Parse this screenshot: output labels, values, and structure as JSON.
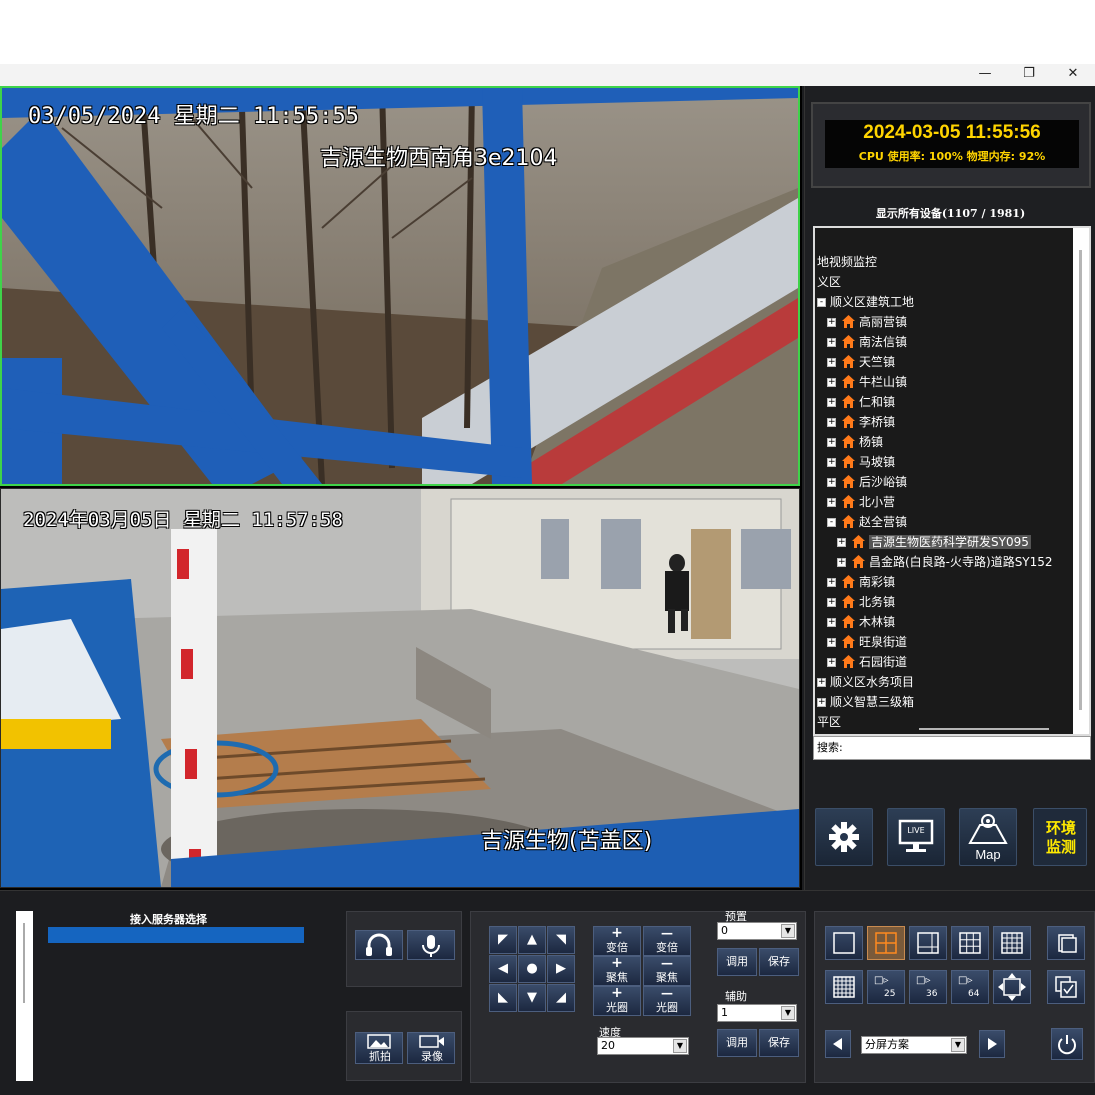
{
  "window": {
    "min_glyph": "—",
    "max_glyph": "❐",
    "close_glyph": "✕"
  },
  "cameras": [
    {
      "osd_time": "03/05/2024  星期二  11:55:55",
      "osd_name": "吉源生物西南角3e2104"
    },
    {
      "osd_time": "2024年03月05日  星期二  11:57:58",
      "osd_name": "吉源生物(苫盖区)"
    }
  ],
  "clock": {
    "datetime": "2024-03-05 11:55:56",
    "stats": "CPU 使用率: 100% 物理内存: 92%"
  },
  "device_header": "显示所有设备(1107 / 1981)",
  "tree": [
    {
      "label": "地视频监控",
      "level": 0,
      "expander": "",
      "icon": false
    },
    {
      "label": "义区",
      "level": 0,
      "expander": "",
      "icon": false
    },
    {
      "label": "顺义区建筑工地",
      "level": 1,
      "expander": "-",
      "icon": false
    },
    {
      "label": "高丽营镇",
      "level": 2,
      "expander": "+",
      "icon": true
    },
    {
      "label": "南法信镇",
      "level": 2,
      "expander": "+",
      "icon": true
    },
    {
      "label": "天竺镇",
      "level": 2,
      "expander": "+",
      "icon": true
    },
    {
      "label": "牛栏山镇",
      "level": 2,
      "expander": "+",
      "icon": true
    },
    {
      "label": "仁和镇",
      "level": 2,
      "expander": "+",
      "icon": true
    },
    {
      "label": "李桥镇",
      "level": 2,
      "expander": "+",
      "icon": true
    },
    {
      "label": "杨镇",
      "level": 2,
      "expander": "+",
      "icon": true
    },
    {
      "label": "马坡镇",
      "level": 2,
      "expander": "+",
      "icon": true
    },
    {
      "label": "后沙峪镇",
      "level": 2,
      "expander": "+",
      "icon": true
    },
    {
      "label": "北小营",
      "level": 2,
      "expander": "+",
      "icon": true
    },
    {
      "label": "赵全营镇",
      "level": 2,
      "expander": "-",
      "icon": true
    },
    {
      "label": "吉源生物医药科学研发SY095",
      "level": 3,
      "expander": "+",
      "icon": true,
      "selected": true
    },
    {
      "label": "昌金路(白良路-火寺路)道路SY152",
      "level": 3,
      "expander": "+",
      "icon": true
    },
    {
      "label": "南彩镇",
      "level": 2,
      "expander": "+",
      "icon": true
    },
    {
      "label": "北务镇",
      "level": 2,
      "expander": "+",
      "icon": true
    },
    {
      "label": "木林镇",
      "level": 2,
      "expander": "+",
      "icon": true
    },
    {
      "label": "旺泉街道",
      "level": 2,
      "expander": "+",
      "icon": true
    },
    {
      "label": "石园街道",
      "level": 2,
      "expander": "+",
      "icon": true
    },
    {
      "label": "顺义区水务项目",
      "level": 1,
      "expander": "+",
      "icon": false
    },
    {
      "label": "顺义智慧三级箱",
      "level": 1,
      "expander": "+",
      "icon": false
    },
    {
      "label": "平区",
      "level": 0,
      "expander": "",
      "icon": false
    }
  ],
  "search_label": "搜索:",
  "right_buttons": {
    "settings_icon": "gear-icon",
    "live_label": "LIVE",
    "map_label": "Map",
    "env_label_1": "环境",
    "env_label_2": "监测"
  },
  "server_select_label": "接入服务器选择",
  "audio": {
    "headphone_glyph": "🎧",
    "mic_glyph": "🎤"
  },
  "capture": {
    "snapshot_label": "抓拍",
    "record_label": "录像"
  },
  "ptz": {
    "zoom_in": "变倍",
    "zoom_out": "变倍",
    "focus_near": "聚焦",
    "focus_far": "聚焦",
    "iris_open": "光圈",
    "iris_close": "光圈",
    "plus": "+",
    "minus": "—",
    "speed_label": "速度",
    "speed_value": "20"
  },
  "preset": {
    "label": "预置",
    "value": "0",
    "call_label": "调用",
    "save_label": "保存"
  },
  "aux": {
    "label": "辅助",
    "value": "1",
    "call_label": "调用",
    "save_label": "保存"
  },
  "layouts": {
    "n25": "25",
    "n36": "36",
    "n64": "64",
    "scheme_value": "分屏方案"
  },
  "colors": {
    "accent_yellow": "#ffd400",
    "active_border": "#3fd34a",
    "tree_icon": "#ff7a1a",
    "server_bar": "#1565c0"
  }
}
